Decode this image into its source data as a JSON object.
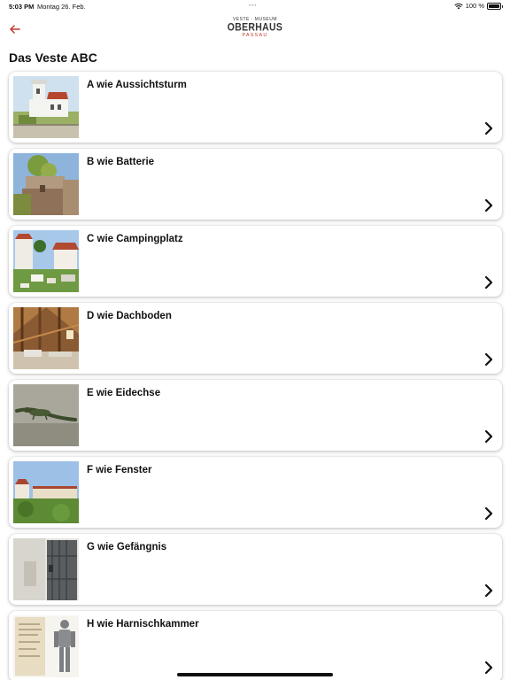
{
  "status_bar": {
    "time": "5:03 PM",
    "date": "Montag 26. Feb.",
    "battery": "100 %",
    "icons": [
      "wifi-icon",
      "battery-icon"
    ]
  },
  "header": {
    "back_icon": "arrow-left-icon",
    "accent_color": "#c0392b",
    "logo": {
      "line1": "VESTE · MUSEUM",
      "line2": "OBERHAUS",
      "line3": "PASSAU"
    }
  },
  "page": {
    "title": "Das Veste ABC"
  },
  "items": [
    {
      "title": "A wie Aussichtsturm",
      "image": "tower-photo"
    },
    {
      "title": "B wie Batterie",
      "image": "battery-fortification-photo"
    },
    {
      "title": "C wie Campingplatz",
      "image": "campsite-photo"
    },
    {
      "title": "D wie Dachboden",
      "image": "attic-photo"
    },
    {
      "title": "E wie Eidechse",
      "image": "lizard-photo"
    },
    {
      "title": "F wie Fenster",
      "image": "fortress-window-view-photo"
    },
    {
      "title": "G wie Gefängnis",
      "image": "prison-door-photo"
    },
    {
      "title": "H wie Harnischkammer",
      "image": "armor-and-document-photo"
    }
  ],
  "item_chevron_icon": "chevron-right-icon"
}
